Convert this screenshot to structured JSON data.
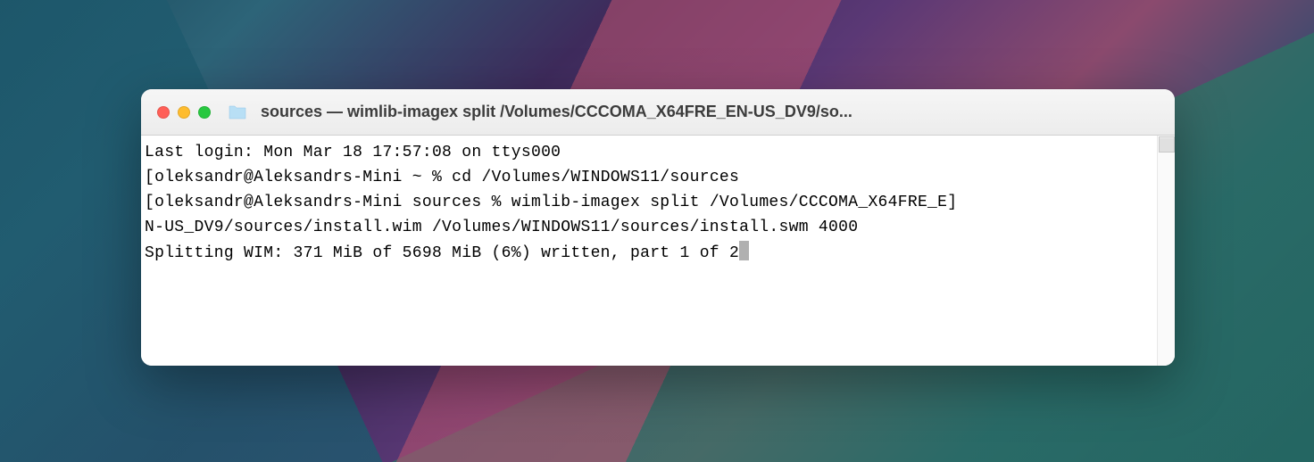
{
  "window": {
    "title": "sources — wimlib-imagex split /Volumes/CCCOMA_X64FRE_EN-US_DV9/so..."
  },
  "terminal": {
    "lines": {
      "last_login": "Last login: Mon Mar 18 17:57:08 on ttys000",
      "prompt1_open": "[",
      "prompt1_user": "oleksandr@Aleksandrs-Mini ~ % ",
      "prompt1_cmd": "cd /Volumes/WINDOWS11/sources",
      "prompt1_close": "]",
      "prompt2_open": "[",
      "prompt2_user": "oleksandr@Aleksandrs-Mini sources % ",
      "prompt2_cmd": "wimlib-imagex split /Volumes/CCCOMA_X64FRE_E",
      "prompt2_close": "]",
      "prompt2_cont": "N-US_DV9/sources/install.wim /Volumes/WINDOWS11/sources/install.swm 4000",
      "progress": "Splitting WIM: 371 MiB of 5698 MiB (6%) written, part 1 of 2"
    }
  }
}
